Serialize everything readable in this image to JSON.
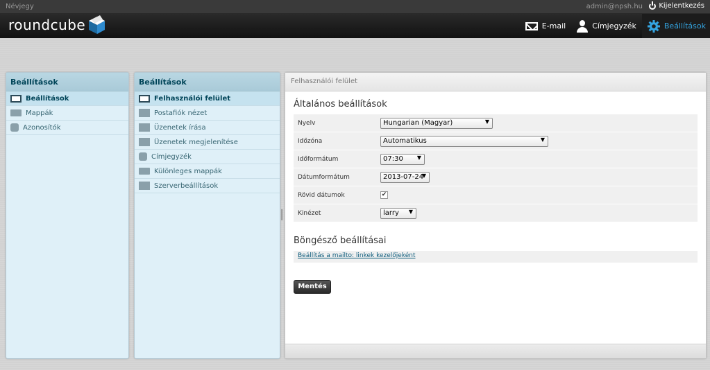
{
  "topline": {
    "about": "Névjegy",
    "user": "admin@npsh.hu",
    "logout": "Kijelentkezés"
  },
  "header": {
    "logo": "roundcube",
    "nav": [
      {
        "label": "E-mail",
        "icon": "mail-icon"
      },
      {
        "label": "Címjegyzék",
        "icon": "person-icon"
      },
      {
        "label": "Beállítások",
        "icon": "gear-icon",
        "active": true
      }
    ],
    "accent": "#34a4e0"
  },
  "sections_panel": {
    "title": "Beállítások",
    "items": [
      {
        "label": "Beállítások",
        "icon": "monitor-icon",
        "selected": true
      },
      {
        "label": "Mappák",
        "icon": "folder-icon"
      },
      {
        "label": "Azonosítók",
        "icon": "person-icon"
      }
    ]
  },
  "prefs_panel": {
    "title": "Beállítások",
    "items": [
      {
        "label": "Felhasználói felület",
        "icon": "monitor-icon",
        "selected": true
      },
      {
        "label": "Postafiók nézet",
        "icon": "mailview-icon"
      },
      {
        "label": "Üzenetek írása",
        "icon": "compose-icon"
      },
      {
        "label": "Üzenetek megjelenítése",
        "icon": "message-icon"
      },
      {
        "label": "Címjegyzék",
        "icon": "addressbook-icon"
      },
      {
        "label": "Különleges mappák",
        "icon": "folder-icon"
      },
      {
        "label": "Szerverbeállítások",
        "icon": "server-icon"
      }
    ]
  },
  "main": {
    "header": "Felhasználói felület",
    "general_title": "Általános beállítások",
    "rows": [
      {
        "label": "Nyelv",
        "value": "Hungarian (Magyar)"
      },
      {
        "label": "Időzóna",
        "value": "Automatikus"
      },
      {
        "label": "Időformátum",
        "value": "07:30"
      },
      {
        "label": "Dátumformátum",
        "value": "2013-07-24"
      },
      {
        "label": "Rövid dátumok",
        "checked": "✔"
      },
      {
        "label": "Kinézet",
        "value": "larry"
      }
    ],
    "browser_title": "Böngésző beállításai",
    "mailto_link": "Beállítás a mailto: linkek kezelőjeként",
    "save_label": "Mentés",
    "select_arrow": "▼"
  }
}
